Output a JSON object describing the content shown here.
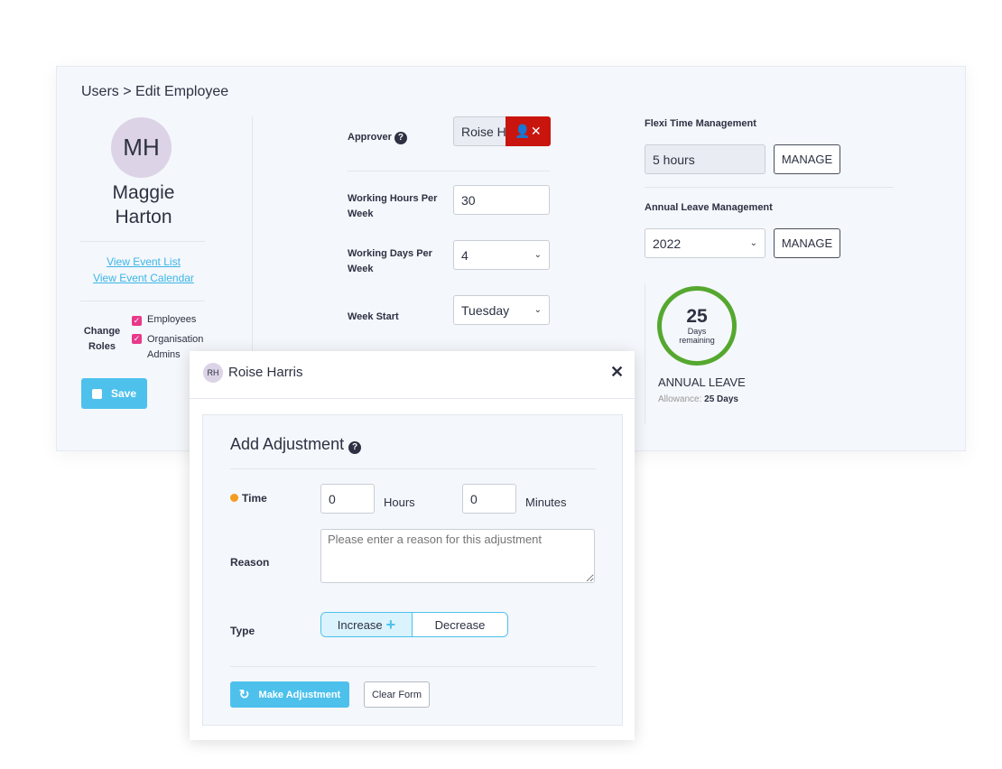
{
  "breadcrumb": "Users > Edit Employee",
  "employee": {
    "initials": "MH",
    "first_name": "Maggie",
    "last_name": "Harton"
  },
  "links": {
    "event_list": "View Event List",
    "event_calendar": "View Event Calendar"
  },
  "roles": {
    "label_line1": "Change",
    "label_line2": "Roles",
    "items": [
      {
        "label": "Employees",
        "checked": true
      },
      {
        "label": "Organisation",
        "label2": "Admins",
        "checked": true
      }
    ]
  },
  "save_label": "Save",
  "form": {
    "approver_label": "Approver",
    "approver_value": "Roise Ha",
    "hours_label1": "Working Hours Per",
    "hours_label2": "Week",
    "hours_value": "30",
    "days_label1": "Working Days Per",
    "days_label2": "Week",
    "days_value": "4",
    "week_start_label": "Week Start",
    "week_start_value": "Tuesday"
  },
  "flexi": {
    "title": "Flexi Time Management",
    "value": "5 hours",
    "manage": "MANAGE"
  },
  "leave": {
    "title": "Annual Leave Management",
    "year": "2022",
    "manage": "MANAGE",
    "days": "25",
    "days_label1": "Days",
    "days_label2": "remaining",
    "heading": "ANNUAL LEAVE",
    "allowance_label": "Allowance:",
    "allowance_value": "25 Days",
    "remaining_fraction": 1.0
  },
  "modal": {
    "initials": "RH",
    "name": "Roise Harris",
    "title": "Add Adjustment",
    "time_label": "Time",
    "hours_value": "0",
    "hours_unit": "Hours",
    "minutes_value": "0",
    "minutes_unit": "Minutes",
    "reason_label": "Reason",
    "reason_placeholder": "Please enter a reason for this adjustment",
    "type_label": "Type",
    "increase": "Increase",
    "decrease": "Decrease",
    "make_adjustment": "Make Adjustment",
    "clear_form": "Clear Form"
  },
  "colors": {
    "accent": "#4dc1ec",
    "danger": "#c8150e",
    "ring": "#55a82f",
    "checkbox": "#e8398a",
    "required_dot": "#f39c1e"
  }
}
